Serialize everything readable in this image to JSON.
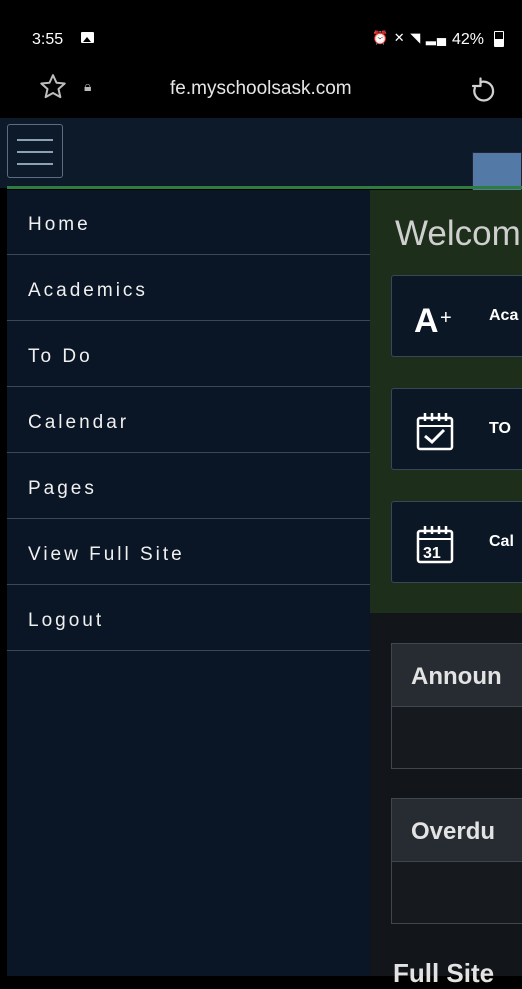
{
  "status_bar": {
    "time": "3:55",
    "battery": "42%"
  },
  "browser": {
    "url": "fe.myschoolsask.com"
  },
  "sidebar": {
    "items": [
      {
        "label": "Home"
      },
      {
        "label": "Academics"
      },
      {
        "label": "To Do"
      },
      {
        "label": "Calendar"
      },
      {
        "label": "Pages"
      },
      {
        "label": "View Full Site"
      },
      {
        "label": "Logout"
      }
    ]
  },
  "main": {
    "welcome": "Welcom",
    "cards": [
      {
        "label": "Aca",
        "icon": "a-plus-icon"
      },
      {
        "label": "TO",
        "icon": "todo-calendar-check-icon"
      },
      {
        "label": "Cal",
        "icon": "calendar-31-icon",
        "icon_text": "31"
      }
    ],
    "panels": [
      {
        "title": "Announ"
      },
      {
        "title": "Overdu"
      }
    ],
    "full_site": "Full Site"
  },
  "colors": {
    "header_bg": "#0d1a29",
    "accent_green": "#2e7d3f",
    "sidebar_bg": "#0a1625",
    "button_blue": "#5379a6"
  }
}
